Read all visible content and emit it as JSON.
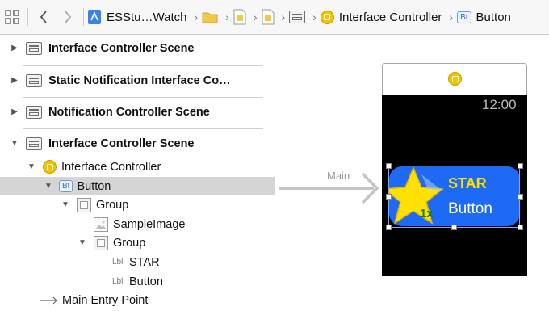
{
  "jumpbar": {
    "crumbs": {
      "project": "ESStu…Watch",
      "scene_ctrl": "Interface Controller",
      "button": "Button"
    },
    "icons": [
      "grid-icon",
      "back-icon",
      "forward-icon",
      "project-icon",
      "folder-icon",
      "storyboard-icon",
      "storyboard-icon",
      "scene-icon",
      "controller-icon",
      "button-icon"
    ]
  },
  "outline": {
    "scenes": [
      "Interface Controller Scene",
      "Static Notification Interface Co…",
      "Notification Controller Scene",
      "Interface Controller Scene"
    ],
    "tree": {
      "controller": "Interface Controller",
      "button": "Button",
      "button_badge": "Bt",
      "group": "Group",
      "image": "SampleImage",
      "inner_group": "Group",
      "label_badge": "Lbl",
      "label_star": "STAR",
      "label_button": "Button",
      "entry": "Main Entry Point"
    }
  },
  "canvas": {
    "main_label": "Main",
    "time": "12:00",
    "button_star": "STAR",
    "button_label": "Button",
    "scale_badge": "1x"
  },
  "colors": {
    "accent": "#1f6af5",
    "star": "#ffe100",
    "controller_icon": "#f4c400",
    "selection": "#d5d5d5"
  }
}
